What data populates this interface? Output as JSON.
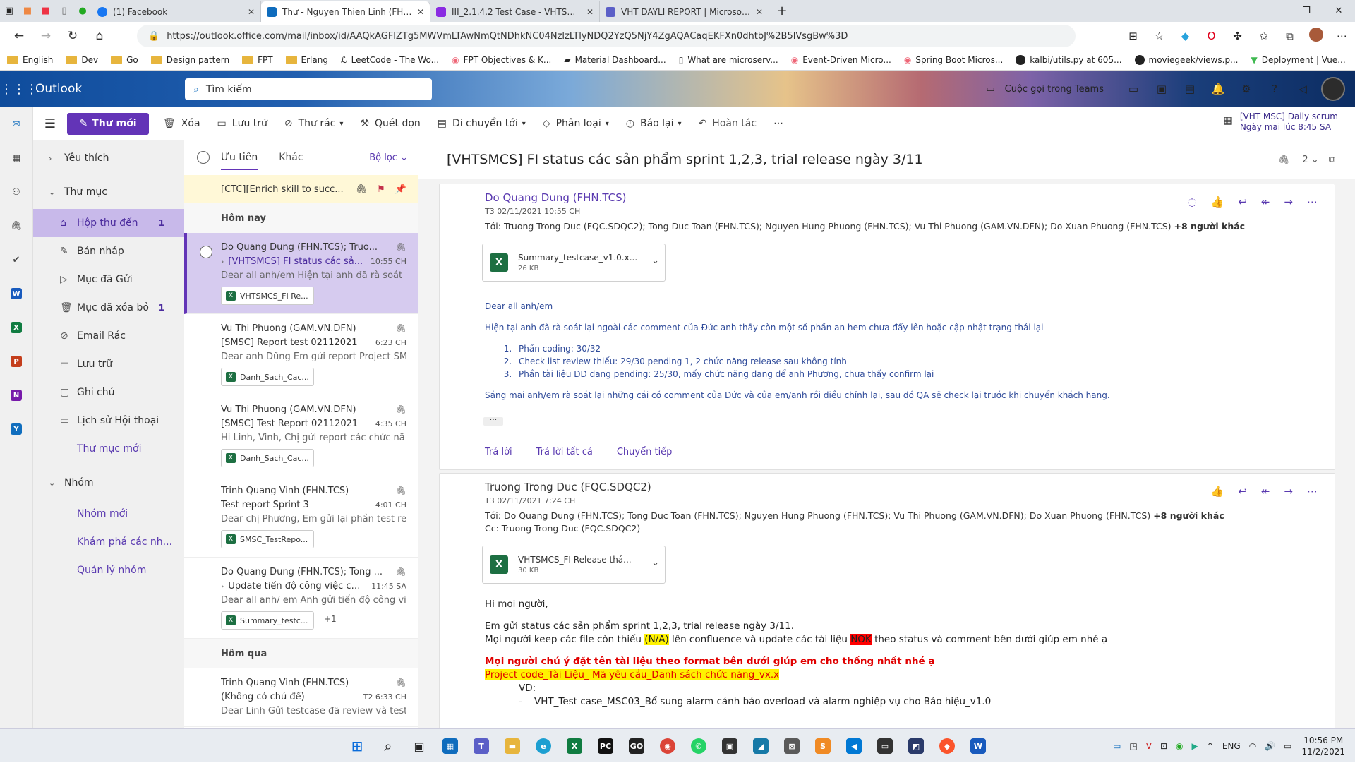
{
  "browser": {
    "tabs": [
      {
        "title": "(1) Facebook",
        "color": "#1877f2"
      },
      {
        "title": "Thư - Nguyen Thien Linh (FHN.TCS)",
        "color": "#0f6cbd"
      },
      {
        "title": "III_2.1.4.2 Test Case - VHTSMCS",
        "color": "#8a2be2"
      },
      {
        "title": "VHT DAYLI REPORT | Microsoft Teams",
        "color": "#5b5fc7"
      }
    ],
    "url": "https://outlook.office.com/mail/inbox/id/AAQkAGFlZTg5MWVmLTAwNmQtNDhkNC04NzlzLTlyNDQ2YzQ5NjY4ZgAQACaqEKFXn0dhtbJ%2B5lVsgBw%3D",
    "bookmarks": [
      "English",
      "Dev",
      "Go",
      "Design pattern",
      "FPT",
      "Erlang",
      "LeetCode - The Wo...",
      "FPT Objectives & K...",
      "Material Dashboard...",
      "What are microserv...",
      "Event-Driven Micro...",
      "Spring Boot Micros...",
      "kalbi/utils.py at 605...",
      "moviegeek/views.p...",
      "Deployment | Vue..."
    ]
  },
  "outlook": {
    "brand": "Outlook",
    "search_placeholder": "Tìm kiếm",
    "teams_call": "Cuộc gọi trong Teams"
  },
  "toolbar": {
    "new_mail": "Thư mới",
    "items": [
      "Xóa",
      "Lưu trữ",
      "Thư rác",
      "Quét dọn",
      "Di chuyển tới",
      "Phân loại",
      "Báo lại",
      "Hoàn tác"
    ],
    "reminder_title": "[VHT MSC] Daily scrum",
    "reminder_time": "Ngày mai lúc 8:45 SA"
  },
  "nav": {
    "favorites": "Yêu thích",
    "folders_header": "Thư mục",
    "folders": [
      {
        "label": "Hộp thư đến",
        "count": "1",
        "icon": "inbox-icon"
      },
      {
        "label": "Bản nháp",
        "count": "",
        "icon": "draft-icon"
      },
      {
        "label": "Mục đã Gửi",
        "count": "",
        "icon": "sent-icon"
      },
      {
        "label": "Mục đã xóa bỏ",
        "count": "1",
        "icon": "trash-icon"
      },
      {
        "label": "Email Rác",
        "count": "",
        "icon": "junk-icon"
      },
      {
        "label": "Lưu trữ",
        "count": "",
        "icon": "archive-icon"
      },
      {
        "label": "Ghi chú",
        "count": "",
        "icon": "notes-icon"
      },
      {
        "label": "Lịch sử Hội thoại",
        "count": "",
        "icon": "history-icon"
      }
    ],
    "new_folder": "Thư mục mới",
    "groups_header": "Nhóm",
    "group_links": [
      "Nhóm mới",
      "Khám phá các nh...",
      "Quản lý nhóm"
    ]
  },
  "list": {
    "tab_focused": "Ưu tiên",
    "tab_other": "Khác",
    "filter": "Bộ lọc",
    "pinned": "[CTC][Enrich skill to succ...",
    "group_today": "Hôm nay",
    "group_yesterday": "Hôm qua",
    "messages": [
      {
        "from": "Do Quang Dung (FHN.TCS); Truo...",
        "subject": "[VHTSMCS] FI status các sả...",
        "time": "10:55 CH",
        "preview": "Dear all anh/em Hiện tại anh đã rà soát l...",
        "attachment": "VHTSMCS_FI Re..."
      },
      {
        "from": "Vu Thi Phuong (GAM.VN.DFN)",
        "subject": "[SMSC] Report test 02112021",
        "time": "6:23 CH",
        "preview": "Dear anh Dũng Em gửi report Project SM...",
        "attachment": "Danh_Sach_Cac..."
      },
      {
        "from": "Vu Thi Phuong (GAM.VN.DFN)",
        "subject": "[SMSC] Test Report 02112021",
        "time": "4:35 CH",
        "preview": "Hi Linh, Vinh, Chị gửi report các chức nă...",
        "attachment": "Danh_Sach_Cac..."
      },
      {
        "from": "Trinh Quang Vinh (FHN.TCS)",
        "subject": "Test report Sprint 3",
        "time": "4:01 CH",
        "preview": "Dear chị Phương, Em gửi lại phần test re...",
        "attachment": "SMSC_TestRepo..."
      },
      {
        "from": "Do Quang Dung (FHN.TCS); Tong ...",
        "subject": "Update tiến độ công việc củ...",
        "time": "11:45 SA",
        "preview": "Dear all anh/ em Anh gửi tiến độ công vi...",
        "attachment": "Summary_testc...",
        "extra": "+1"
      }
    ],
    "yesterday_message": {
      "from": "Trinh Quang Vinh (FHN.TCS)",
      "subject": "(Không có chủ đề)",
      "time": "T2 6:33 CH",
      "preview": "Dear Linh Gửi testcase đã review và test ..."
    }
  },
  "reading": {
    "title": "[VHTSMCS] FI status các sản phẩm sprint 1,2,3, trial release ngày 3/11",
    "count": "2",
    "email1": {
      "sender": "Do Quang Dung (FHN.TCS)",
      "date": "T3 02/11/2021 10:55 CH",
      "to_label": "Tới:",
      "to": "Truong Trong Duc (FQC.SDQC2); Tong Duc Toan (FHN.TCS); Nguyen Hung Phuong (FHN.TCS); Vu Thi Phuong (GAM.VN.DFN); Do Xuan Phuong (FHN.TCS)",
      "more": "+8 người khác",
      "attachment": "Summary_testcase_v1.0.x...",
      "attachment_size": "26 KB",
      "greeting": "Dear all anh/em",
      "line1": "Hiện tại anh đã rà soát lại ngoài các comment của Đức anh thấy còn một số phần an hem chưa đẩy lên hoặc cập nhật trạng thái lại",
      "points": [
        "Phần coding: 30/32",
        "Check list review thiếu: 29/30  pending 1, 2 chức năng release sau không tính",
        "Phần tài liệu DD đang pending: 25/30, mấy chức năng đang để anh Phương, chưa thấy confirm lại"
      ],
      "line2": "Sáng mai anh/em rà soát lại những cái có comment của Đức và của em/anh rồi điều chỉnh lại, sau đó QA sẽ check lại trước khi chuyển khách hang.",
      "reply": "Trả lời",
      "reply_all": "Trả lời tất cả",
      "forward": "Chuyển tiếp"
    },
    "email2": {
      "sender": "Truong Trong Duc (FQC.SDQC2)",
      "date": "T3 02/11/2021 7:24 CH",
      "to_label": "Tới:",
      "to": "Do Quang Dung (FHN.TCS); Tong Duc Toan (FHN.TCS); Nguyen Hung Phuong (FHN.TCS); Vu Thi Phuong (GAM.VN.DFN); Do Xuan Phuong (FHN.TCS)",
      "more": "+8 người khác",
      "cc_label": "Cc:",
      "cc": "Truong Trong Duc (FQC.SDQC2)",
      "attachment": "VHTSMCS_FI Release thá...",
      "attachment_size": "30 KB",
      "greeting": "Hi mọi người,",
      "line1": "Em gửi status các sản phẩm sprint 1,2,3, trial release ngày 3/11.",
      "line2a": "Mọi người keep các file còn thiếu",
      "na": "(N/A)",
      "line2b": "lên confluence và update các tài liệu",
      "nok": "NOK",
      "line2c": "theo status và comment bên dưới giúp em nhé ạ",
      "warn": "Mọi người chú ý đặt tên tài liệu theo format bên dưới giúp em cho thống nhất nhé ạ",
      "format": "Project code_Tài Liệu_ Mã yêu cầu_Danh sách chức năng_vx.x",
      "vd": "VD:",
      "example": "VHT_Test case_MSC03_Bổ sung alarm cảnh báo overload và alarm nghiệp vụ cho Báo hiệu_v1.0"
    }
  },
  "taskbar": {
    "lang": "ENG",
    "time": "10:56 PM",
    "date": "11/2/2021"
  }
}
